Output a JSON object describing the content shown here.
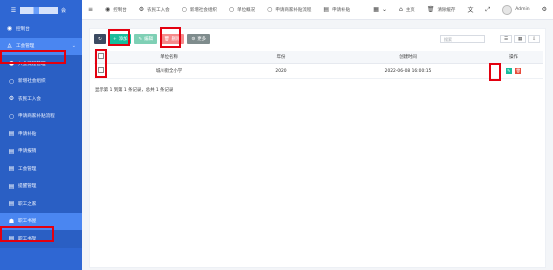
{
  "brand": {
    "logo_text": "会"
  },
  "sidebar": {
    "items": [
      {
        "label": "控制台",
        "icon": "dashboard-icon"
      },
      {
        "label": "工会管理",
        "icon": "user-group-icon",
        "chevron": "⌄"
      },
      {
        "label": "入会流程管理",
        "icon": "user-icon"
      },
      {
        "label": "新增社会组织",
        "icon": "circle-icon"
      },
      {
        "label": "农民工入会",
        "icon": "gear-icon"
      },
      {
        "label": "申请商家补贴流程",
        "icon": "circle-icon"
      },
      {
        "label": "申请补贴",
        "icon": "file-icon"
      },
      {
        "label": "申请报销",
        "icon": "file-icon"
      },
      {
        "label": "工会管理",
        "icon": "file-icon"
      },
      {
        "label": "提醒管理",
        "icon": "file-icon"
      },
      {
        "label": "职工之家",
        "icon": "file-icon"
      },
      {
        "label": "职工书屋",
        "icon": "book-icon"
      },
      {
        "label": "职工书架",
        "icon": "file-icon"
      }
    ]
  },
  "topbar": {
    "items": [
      {
        "label": "",
        "icon": "menu-icon"
      },
      {
        "label": "控制台",
        "icon": "dashboard-icon"
      },
      {
        "label": "农民工入会",
        "icon": "gear-icon"
      },
      {
        "label": "新增社会组织",
        "icon": "circle-icon"
      },
      {
        "label": "单位概况",
        "icon": "circle-icon"
      },
      {
        "label": "申请商家补贴流程",
        "icon": "circle-icon"
      },
      {
        "label": "申请补贴",
        "icon": "file-icon"
      }
    ],
    "right": [
      {
        "label": "",
        "icon": "dropdown-icon"
      },
      {
        "label": "主页",
        "icon": "home-icon"
      },
      {
        "label": "清除缓存",
        "icon": "trash-icon"
      },
      {
        "label": "",
        "icon": "language-icon"
      },
      {
        "label": "",
        "icon": "fullscreen-icon"
      }
    ],
    "username": "Admin",
    "settings_icon": "gear-icon"
  },
  "toolbar": {
    "refresh_label": "↻",
    "add_label": "添加",
    "edit_label": "编辑",
    "delete_label": "删除",
    "more_label": "更多"
  },
  "search": {
    "placeholder": "搜索"
  },
  "table": {
    "headers": [
      "单位名称",
      "年份",
      "创建时间",
      "操作"
    ],
    "rows": [
      {
        "name": "城川街全小学",
        "year": "2020",
        "created": "2022-06-08 16:00:15"
      }
    ]
  },
  "pagination": {
    "summary": "显示第 1 到第 1 条记录，总共 1 条记录"
  },
  "colors": {
    "sidebar": "#2f67d3",
    "accent_add": "#18bc9c",
    "accent_delete": "#e74c3c",
    "highlight": "#e3000f"
  }
}
